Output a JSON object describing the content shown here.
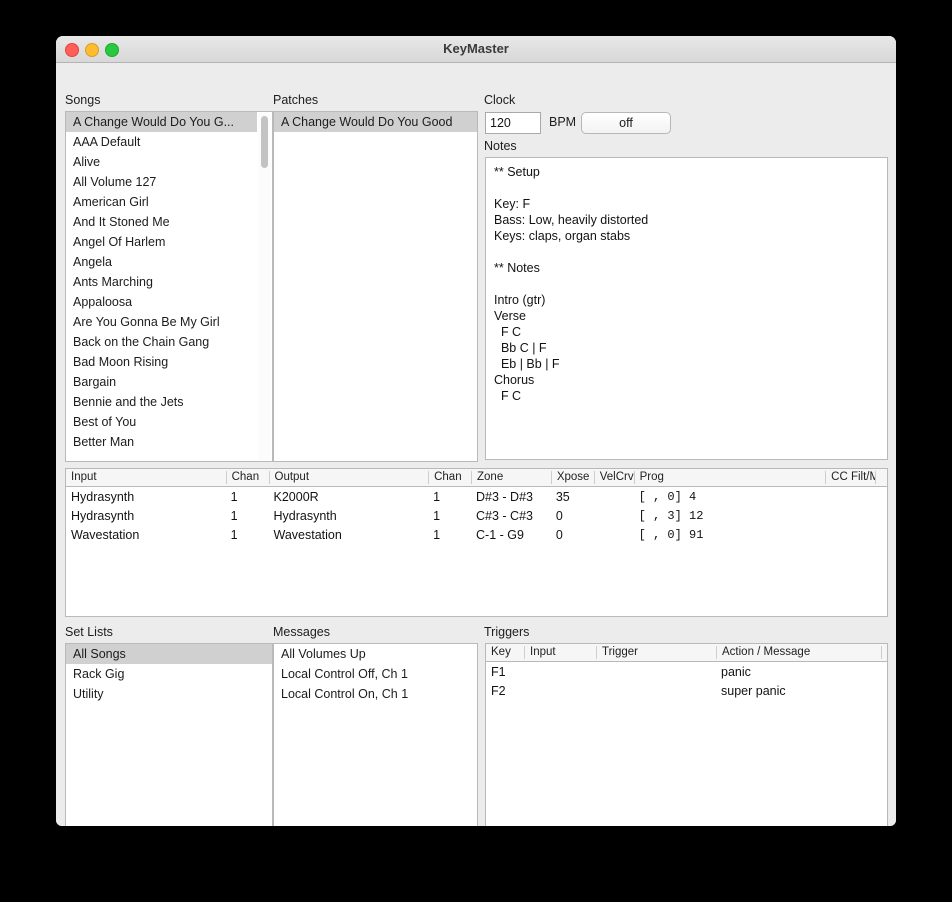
{
  "window": {
    "title": "KeyMaster",
    "traffic_lights": [
      "close",
      "minimize",
      "maximize"
    ]
  },
  "songs": {
    "label": "Songs",
    "selected": "A Change Would Do You G...",
    "items": [
      "A Change Would Do You G...",
      "AAA Default",
      "Alive",
      "All Volume 127",
      "American Girl",
      "And It Stoned Me",
      "Angel Of Harlem",
      "Angela",
      "Ants Marching",
      "Appaloosa",
      "Are You Gonna Be My Girl",
      "Back on the Chain Gang",
      "Bad Moon Rising",
      "Bargain",
      "Bennie and the Jets",
      "Best of You",
      "Better Man"
    ]
  },
  "patches": {
    "label": "Patches",
    "items": [
      "A Change Would Do You Good"
    ],
    "selected": "A Change Would Do You Good"
  },
  "clock": {
    "label": "Clock",
    "bpm_value": "120",
    "bpm_label": "BPM",
    "toggle_value": "off"
  },
  "notes": {
    "label": "Notes",
    "text": "** Setup\n\nKey: F\nBass: Low, heavily distorted\nKeys: claps, organ stabs\n\n** Notes\n\nIntro (gtr)\nVerse\n  F C\n  Bb C | F\n  Eb | Bb | F\nChorus\n  F C"
  },
  "connections": {
    "columns": [
      "Input",
      "Chan",
      "Output",
      "Chan",
      "Zone",
      "Xpose",
      "VelCrv",
      "Prog",
      "CC Filt/Map",
      ""
    ],
    "rows": [
      {
        "input": "Hydrasynth",
        "in_chan": "1",
        "output": "K2000R",
        "out_chan": "1",
        "zone": "D#3 - D#3",
        "xpose": "35",
        "velcrv": "",
        "prog": "[  ,  0]   4",
        "cc": "",
        "extra": ""
      },
      {
        "input": "Hydrasynth",
        "in_chan": "1",
        "output": "Hydrasynth",
        "out_chan": "1",
        "zone": "C#3 - C#3",
        "xpose": "0",
        "velcrv": "",
        "prog": "[  ,  3]  12",
        "cc": "",
        "extra": ""
      },
      {
        "input": "Wavestation",
        "in_chan": "1",
        "output": "Wavestation",
        "out_chan": "1",
        "zone": "C-1 - G9",
        "xpose": "0",
        "velcrv": "",
        "prog": "[  ,  0]  91",
        "cc": "",
        "extra": ""
      }
    ]
  },
  "setlists": {
    "label": "Set Lists",
    "items": [
      "All Songs",
      "Rack Gig",
      "Utility"
    ],
    "selected": "All Songs"
  },
  "messages": {
    "label": "Messages",
    "items": [
      "All Volumes Up",
      "Local Control Off, Ch 1",
      "Local Control On, Ch 1"
    ]
  },
  "triggers": {
    "label": "Triggers",
    "columns": [
      "Key",
      "Input",
      "Trigger",
      "Action / Message",
      ""
    ],
    "rows": [
      {
        "key": "F1",
        "input": "",
        "trigger": "",
        "action": "panic",
        "extra": ""
      },
      {
        "key": "F2",
        "input": "",
        "trigger": "",
        "action": "super panic",
        "extra": ""
      }
    ]
  },
  "colors": {
    "window_bg": "#ececec",
    "list_bg": "#ffffff",
    "selection": "#d0d0d0",
    "border": "#b9b9b9",
    "traffic_close": "#ff5f57",
    "traffic_min": "#febc2e",
    "traffic_max": "#28c840"
  }
}
